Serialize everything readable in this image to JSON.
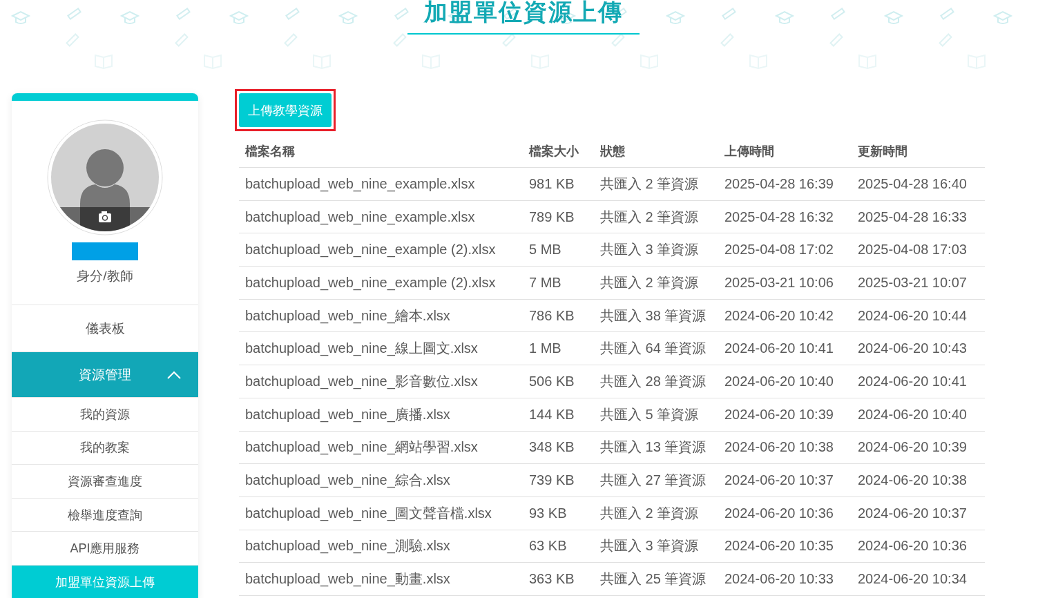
{
  "page_title": "加盟單位資源上傳",
  "profile": {
    "role": "身分/教師"
  },
  "sidebar": {
    "items": [
      {
        "label": "儀表板",
        "selected": false
      },
      {
        "label": "資源管理",
        "selected": false,
        "expanded": true,
        "children": [
          {
            "label": "我的資源",
            "selected": false
          },
          {
            "label": "我的教案",
            "selected": false
          },
          {
            "label": "資源審查進度",
            "selected": false
          },
          {
            "label": "檢舉進度查詢",
            "selected": false
          },
          {
            "label": "API應用服務",
            "selected": false
          },
          {
            "label": "加盟單位資源上傳",
            "selected": true
          }
        ]
      }
    ]
  },
  "upload_button": {
    "label": "上傳教學資源",
    "highlighted": true
  },
  "table": {
    "columns": [
      "檔案名稱",
      "檔案大小",
      "狀態",
      "上傳時間",
      "更新時間"
    ],
    "rows": [
      [
        "batchupload_web_nine_example.xlsx",
        "981 KB",
        "共匯入 2 筆資源",
        "2025-04-28 16:39",
        "2025-04-28 16:40"
      ],
      [
        "batchupload_web_nine_example.xlsx",
        "789 KB",
        "共匯入 2 筆資源",
        "2025-04-28 16:32",
        "2025-04-28 16:33"
      ],
      [
        "batchupload_web_nine_example (2).xlsx",
        "5 MB",
        "共匯入 3 筆資源",
        "2025-04-08 17:02",
        "2025-04-08 17:03"
      ],
      [
        "batchupload_web_nine_example (2).xlsx",
        "7 MB",
        "共匯入 2 筆資源",
        "2025-03-21 10:06",
        "2025-03-21 10:07"
      ],
      [
        "batchupload_web_nine_繪本.xlsx",
        "786 KB",
        "共匯入 38 筆資源",
        "2024-06-20 10:42",
        "2024-06-20 10:44"
      ],
      [
        "batchupload_web_nine_線上圖文.xlsx",
        "1 MB",
        "共匯入 64 筆資源",
        "2024-06-20 10:41",
        "2024-06-20 10:43"
      ],
      [
        "batchupload_web_nine_影音數位.xlsx",
        "506 KB",
        "共匯入 28 筆資源",
        "2024-06-20 10:40",
        "2024-06-20 10:41"
      ],
      [
        "batchupload_web_nine_廣播.xlsx",
        "144 KB",
        "共匯入 5 筆資源",
        "2024-06-20 10:39",
        "2024-06-20 10:40"
      ],
      [
        "batchupload_web_nine_網站學習.xlsx",
        "348 KB",
        "共匯入 13 筆資源",
        "2024-06-20 10:38",
        "2024-06-20 10:39"
      ],
      [
        "batchupload_web_nine_綜合.xlsx",
        "739 KB",
        "共匯入 27 筆資源",
        "2024-06-20 10:37",
        "2024-06-20 10:38"
      ],
      [
        "batchupload_web_nine_圖文聲音檔.xlsx",
        "93 KB",
        "共匯入 2 筆資源",
        "2024-06-20 10:36",
        "2024-06-20 10:37"
      ],
      [
        "batchupload_web_nine_測驗.xlsx",
        "63 KB",
        "共匯入 3 筆資源",
        "2024-06-20 10:35",
        "2024-06-20 10:36"
      ],
      [
        "batchupload_web_nine_動畫.xlsx",
        "363 KB",
        "共匯入 25 筆資源",
        "2024-06-20 10:33",
        "2024-06-20 10:34"
      ]
    ]
  }
}
